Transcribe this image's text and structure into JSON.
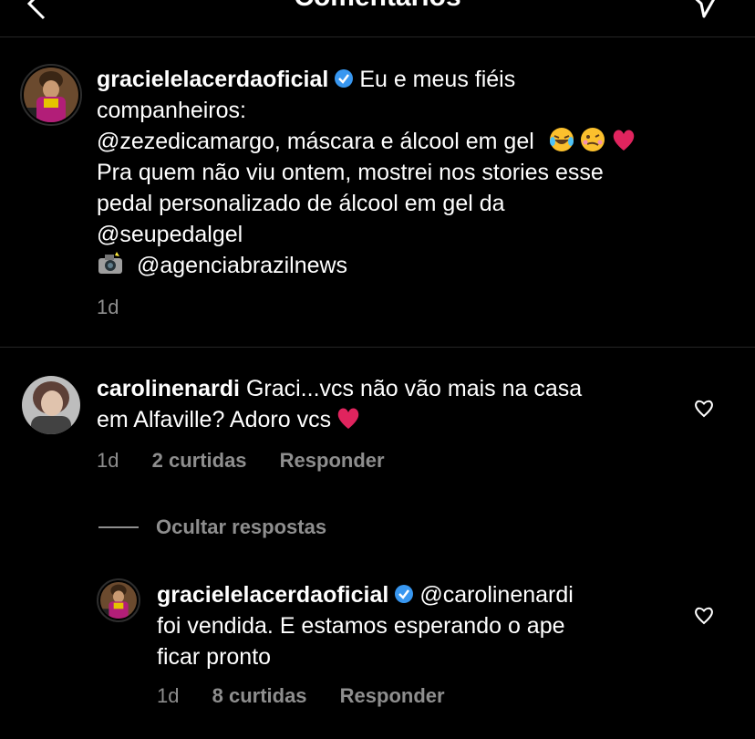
{
  "header": {
    "title": "Comentários"
  },
  "post": {
    "username": "gracielelacerdaoficial",
    "caption_line1": "Eu e meus fiéis",
    "caption_line2": "companheiros:",
    "caption_line3_mention": "@zezedicamargo",
    "caption_line3_rest": ", máscara e álcool em gel",
    "caption_line4": "Pra quem não viu ontem, mostrei nos stories esse",
    "caption_line5": "pedal personalizado de álcool em gel da",
    "caption_line6": "@seupedalgel",
    "caption_line7": "@agenciabrazilnews",
    "time": "1d"
  },
  "comments": [
    {
      "username": "carolinenardi",
      "text_line1": "Graci...vcs não vão mais na casa",
      "text_line2": "em Alfaville? Adoro vcs",
      "time": "1d",
      "likes": "2 curtidas",
      "reply_label": "Responder"
    }
  ],
  "hide_replies_label": "Ocultar respostas",
  "replies": [
    {
      "username": "gracielelacerdaoficial",
      "mention": "@carolinenardi",
      "text_line2": "foi vendida. E estamos esperando o ape",
      "text_line3": "ficar pronto",
      "time": "1d",
      "likes": "8 curtidas",
      "reply_label": "Responder"
    }
  ],
  "icons": {
    "back": "chevron-left-icon",
    "send": "paper-plane-icon",
    "verified": "verified-badge-icon",
    "heart": "heart-outline-icon",
    "camera": "camera-flash-icon"
  },
  "colors": {
    "background": "#000000",
    "text": "#ffffff",
    "meta": "#8e8e8e",
    "verified": "#3897f0",
    "divider": "#262626"
  }
}
